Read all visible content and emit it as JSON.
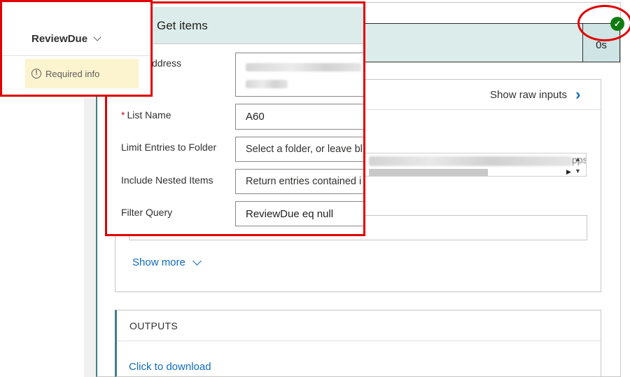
{
  "action_card": {
    "duration": "0s",
    "status_icon": "check-icon",
    "status_color": "#107c10",
    "show_raw_inputs": "Show raw inputs",
    "show_more": "Show more",
    "outputs_label": "OUTPUTS",
    "download_link": "Click to download",
    "blurred_url_suffix": "pps"
  },
  "get_items": {
    "title": "Get items",
    "fields": [
      {
        "label": "ddress",
        "required": false,
        "value": ""
      },
      {
        "label": "List Name",
        "required": true,
        "value": "A60"
      },
      {
        "label": "Limit Entries to Folder",
        "required": false,
        "value": "Select a folder, or leave bl"
      },
      {
        "label": "Include Nested Items",
        "required": false,
        "value": "Return entries contained i"
      },
      {
        "label": "Filter Query",
        "required": false,
        "value": "ReviewDue eq null"
      }
    ]
  },
  "column": {
    "name": "ReviewDue",
    "required_text": "Required info"
  },
  "colors": {
    "accent_teal": "#3f7f86",
    "header_bg": "#dcecea",
    "link_blue": "#0f6cbd",
    "highlight_red": "#e00000",
    "required_bg": "#fcf3cf"
  }
}
